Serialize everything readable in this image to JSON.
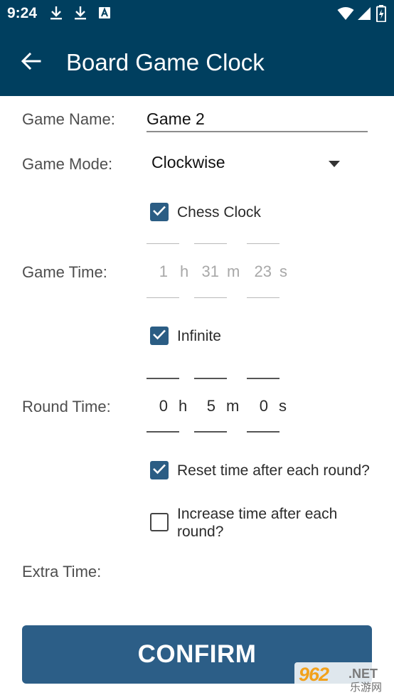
{
  "status_bar": {
    "time": "9:24",
    "left_icons": [
      "download-icon",
      "download-icon",
      "font-badge-icon"
    ],
    "right_icons": [
      "wifi-icon",
      "cell-signal-icon",
      "battery-icon"
    ]
  },
  "app_bar": {
    "title": "Board Game Clock",
    "background": "#003f5f"
  },
  "form": {
    "game_name": {
      "label": "Game Name:",
      "value": "Game 2"
    },
    "game_mode": {
      "label": "Game Mode:",
      "value": "Clockwise"
    },
    "chess_clock": {
      "label": "Chess Clock",
      "checked": true
    },
    "game_time": {
      "label": "Game Time:",
      "hours": "1",
      "hours_unit": "h",
      "minutes": "31",
      "minutes_unit": "m",
      "seconds": "23",
      "seconds_unit": "s",
      "disabled": true
    },
    "infinite": {
      "label": "Infinite",
      "checked": true
    },
    "round_time": {
      "label": "Round Time:",
      "hours": "0",
      "hours_unit": "h",
      "minutes": "5",
      "minutes_unit": "m",
      "seconds": "0",
      "seconds_unit": "s"
    },
    "reset_time": {
      "label": "Reset time after each round?",
      "checked": true
    },
    "increase_time": {
      "label_line1": "Increase time after each",
      "label_line2": "round?",
      "checked": false
    },
    "extra_time": {
      "label": "Extra Time:"
    }
  },
  "confirm_button": {
    "label": "CONFIRM",
    "color": "#2c5e87"
  },
  "watermark": {
    "number": "962",
    "suffix": ".NET",
    "sub": "乐游网"
  }
}
